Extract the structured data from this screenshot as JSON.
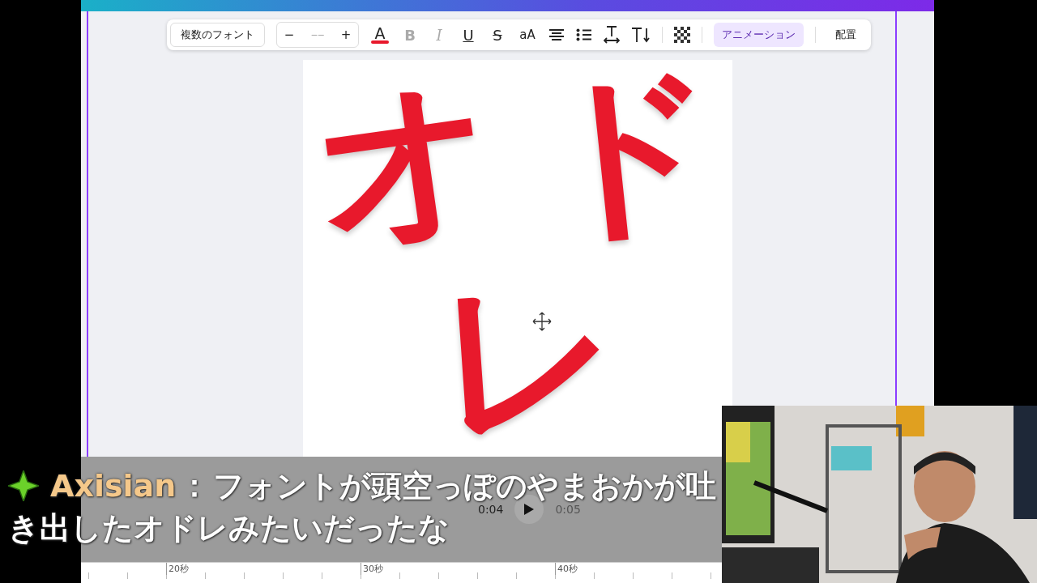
{
  "toolbar": {
    "font": "複数のフォント",
    "size": {
      "minus": "−",
      "placeholder": "−−",
      "plus": "+"
    },
    "text_color": {
      "label": "A",
      "color": "#e8192c"
    },
    "format": [
      {
        "label": "B",
        "kind": "bold",
        "disabled": true
      },
      {
        "label": "I",
        "kind": "italic",
        "disabled": true
      },
      {
        "label": "U",
        "kind": "underline",
        "disabled": false
      },
      {
        "label": "S",
        "kind": "strike",
        "disabled": false
      },
      {
        "label": "aA",
        "kind": "case",
        "disabled": false
      }
    ],
    "animation": {
      "label": "アニメーション",
      "selected": true
    },
    "position": {
      "label": "配置",
      "selected": false
    }
  },
  "design": {
    "glyphs": [
      "オ",
      "ド",
      "レ"
    ]
  },
  "player": {
    "current": "0:04",
    "next": "0:05"
  },
  "ruler": [
    "20秒",
    "30秒",
    "40秒"
  ],
  "chat": {
    "user": "Axisian",
    "separator": "：",
    "lines": [
      "フォントが頭空っぽのやまおかが吐",
      "き出したオドレみたいだったな"
    ]
  }
}
